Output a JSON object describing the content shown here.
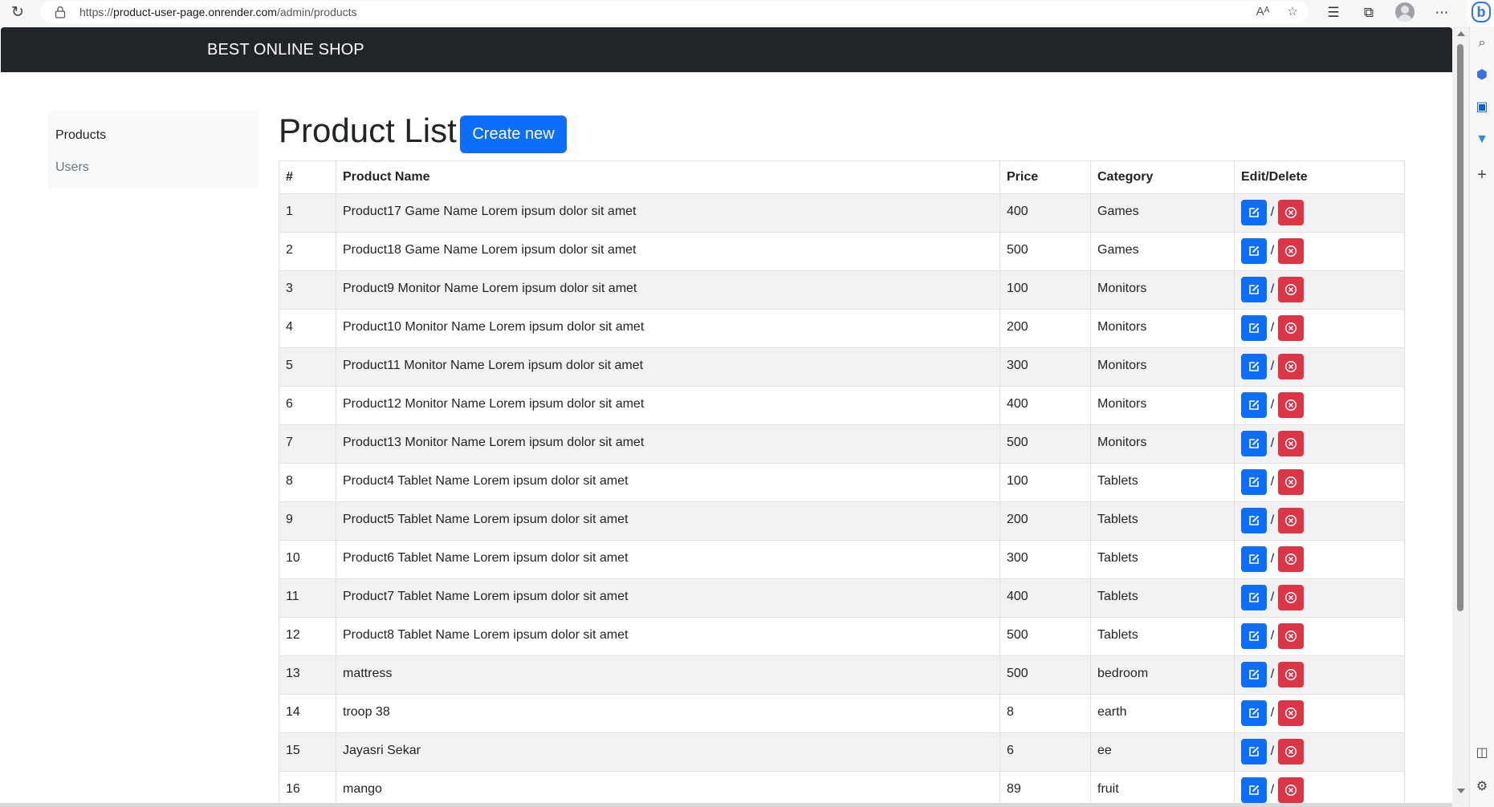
{
  "browser": {
    "url_scheme": "https://",
    "url_domain": "product-user-page.onrender.com",
    "url_path": "/admin/products",
    "icons": [
      "reload-icon",
      "lock-icon",
      "read-aloud-icon",
      "favorite-icon",
      "favorites-icon",
      "collections-icon",
      "profile-icon",
      "more-icon",
      "bing-icon"
    ],
    "side_rail_icons": [
      "search-icon",
      "copilot-icon",
      "outlook-icon",
      "tools-icon",
      "add-icon",
      "sidebar-toggle-icon",
      "settings-icon"
    ]
  },
  "navbar": {
    "brand": "BEST ONLINE SHOP"
  },
  "sidebar": {
    "items": [
      {
        "label": "Products"
      },
      {
        "label": "Users"
      }
    ]
  },
  "main": {
    "title": "Product List",
    "create_label": "Create new"
  },
  "table": {
    "headers": [
      "#",
      "Product Name",
      "Price",
      "Category",
      "Edit/Delete"
    ],
    "separator": "/",
    "rows": [
      {
        "num": "1",
        "name": "Product17 Game Name Lorem ipsum dolor sit amet",
        "price": "400",
        "category": "Games"
      },
      {
        "num": "2",
        "name": "Product18 Game Name Lorem ipsum dolor sit amet",
        "price": "500",
        "category": "Games"
      },
      {
        "num": "3",
        "name": "Product9 Monitor Name Lorem ipsum dolor sit amet",
        "price": "100",
        "category": "Monitors"
      },
      {
        "num": "4",
        "name": "Product10 Monitor Name Lorem ipsum dolor sit amet",
        "price": "200",
        "category": "Monitors"
      },
      {
        "num": "5",
        "name": "Product11 Monitor Name Lorem ipsum dolor sit amet",
        "price": "300",
        "category": "Monitors"
      },
      {
        "num": "6",
        "name": "Product12 Monitor Name Lorem ipsum dolor sit amet",
        "price": "400",
        "category": "Monitors"
      },
      {
        "num": "7",
        "name": "Product13 Monitor Name Lorem ipsum dolor sit amet",
        "price": "500",
        "category": "Monitors"
      },
      {
        "num": "8",
        "name": "Product4 Tablet Name Lorem ipsum dolor sit amet",
        "price": "100",
        "category": "Tablets"
      },
      {
        "num": "9",
        "name": "Product5 Tablet Name Lorem ipsum dolor sit amet",
        "price": "200",
        "category": "Tablets"
      },
      {
        "num": "10",
        "name": "Product6 Tablet Name Lorem ipsum dolor sit amet",
        "price": "300",
        "category": "Tablets"
      },
      {
        "num": "11",
        "name": "Product7 Tablet Name Lorem ipsum dolor sit amet",
        "price": "400",
        "category": "Tablets"
      },
      {
        "num": "12",
        "name": "Product8 Tablet Name Lorem ipsum dolor sit amet",
        "price": "500",
        "category": "Tablets"
      },
      {
        "num": "13",
        "name": "mattress",
        "price": "500",
        "category": "bedroom"
      },
      {
        "num": "14",
        "name": "troop 38",
        "price": "8",
        "category": "earth"
      },
      {
        "num": "15",
        "name": "Jayasri Sekar",
        "price": "6",
        "category": "ee"
      },
      {
        "num": "16",
        "name": "mango",
        "price": "89",
        "category": "fruit"
      }
    ]
  },
  "colors": {
    "navbar_bg": "#212529",
    "primary": "#0d6efd",
    "danger": "#dc3545",
    "stripe": "#f2f2f2",
    "sidebar_bg": "#f8f9fa",
    "muted_text": "#6c757d"
  }
}
